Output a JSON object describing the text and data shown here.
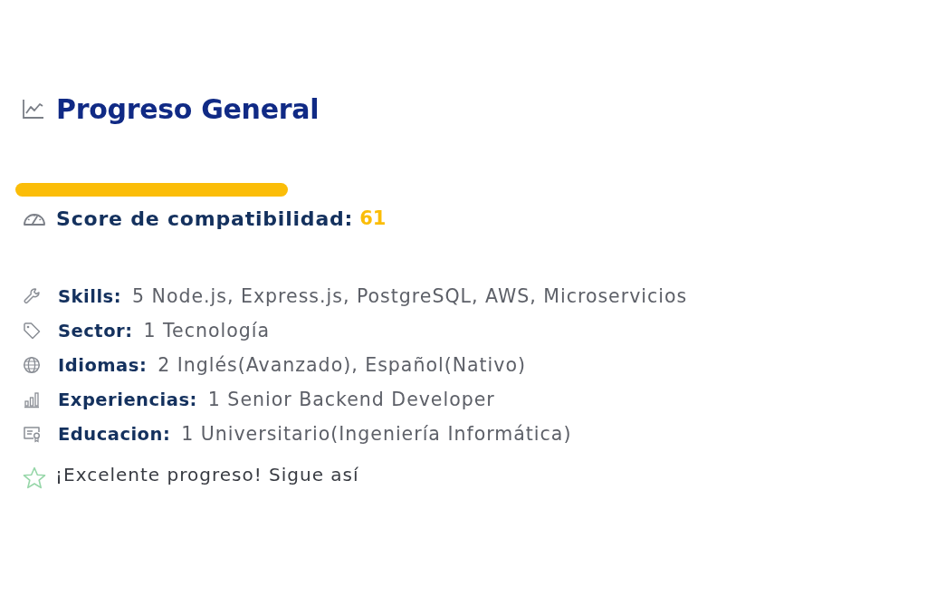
{
  "header": {
    "title": "Progreso General"
  },
  "score": {
    "label": "Score de compatibilidad:",
    "value": "61"
  },
  "summary": [
    {
      "label": "Skills:",
      "value": "5 Node.js, Express.js, PostgreSQL, AWS, Microservicios"
    },
    {
      "label": "Sector:",
      "value": "1 Tecnología"
    },
    {
      "label": "Idiomas:",
      "value": "2 Inglés(Avanzado), Español(Nativo)"
    },
    {
      "label": "Experiencias:",
      "value": "1 Senior Backend Developer"
    },
    {
      "label": "Educacion:",
      "value": "1 Universitario(Ingeniería Informática)"
    }
  ],
  "message": {
    "text": "¡Excelente progreso! Sigue así"
  }
}
